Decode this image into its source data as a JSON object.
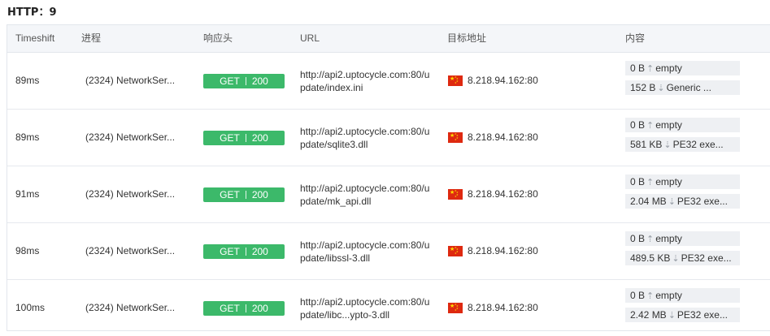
{
  "title": "HTTP：9",
  "columns": [
    "Timeshift",
    "进程",
    "响应头",
    "URL",
    "目标地址",
    "内容"
  ],
  "rows": [
    {
      "time": "89ms",
      "process": "(2324) NetworkSer...",
      "method": "GET",
      "status": "200",
      "url": "http://api2.uptocycle.com:80/update/index.ini",
      "ip": "8.218.94.162:80",
      "up_size": "0 B",
      "up_type": "empty",
      "down_size": "152 B",
      "down_type": "Generic ..."
    },
    {
      "time": "89ms",
      "process": "(2324) NetworkSer...",
      "method": "GET",
      "status": "200",
      "url": "http://api2.uptocycle.com:80/update/sqlite3.dll",
      "ip": "8.218.94.162:80",
      "up_size": "0 B",
      "up_type": "empty",
      "down_size": "581 KB",
      "down_type": "PE32 exe..."
    },
    {
      "time": "91ms",
      "process": "(2324) NetworkSer...",
      "method": "GET",
      "status": "200",
      "url": "http://api2.uptocycle.com:80/update/mk_api.dll",
      "ip": "8.218.94.162:80",
      "up_size": "0 B",
      "up_type": "empty",
      "down_size": "2.04 MB",
      "down_type": "PE32 exe..."
    },
    {
      "time": "98ms",
      "process": "(2324) NetworkSer...",
      "method": "GET",
      "status": "200",
      "url": "http://api2.uptocycle.com:80/update/libssl-3.dll",
      "ip": "8.218.94.162:80",
      "up_size": "0 B",
      "up_type": "empty",
      "down_size": "489.5 KB",
      "down_type": "PE32 exe..."
    },
    {
      "time": "100ms",
      "process": "(2324) NetworkSer...",
      "method": "GET",
      "status": "200",
      "url": "http://api2.uptocycle.com:80/update/libc...ypto-3.dll",
      "ip": "8.218.94.162:80",
      "up_size": "0 B",
      "up_type": "empty",
      "down_size": "2.42 MB",
      "down_type": "PE32 exe..."
    }
  ],
  "icons": {
    "upload": "arrow-up-icon",
    "download": "arrow-down-icon",
    "flag": "china-flag-icon"
  },
  "colors": {
    "badge": "#3cb96a",
    "header_bg": "#f4f6f9",
    "pill_bg": "#eef0f3"
  }
}
